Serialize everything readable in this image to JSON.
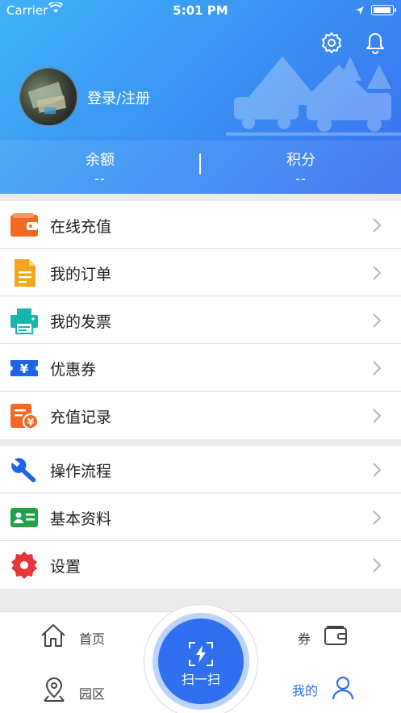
{
  "status_bar": {
    "carrier": "Carrier",
    "time": "5:01 PM"
  },
  "header": {
    "login_label": "登录/注册"
  },
  "stats": {
    "balance": {
      "label": "余额",
      "value": "--"
    },
    "points": {
      "label": "积分",
      "value": "--"
    }
  },
  "menu": {
    "group1": [
      {
        "label": "在线充值",
        "icon": "wallet-icon"
      },
      {
        "label": "我的订单",
        "icon": "document-icon"
      },
      {
        "label": "我的发票",
        "icon": "printer-icon"
      },
      {
        "label": "优惠券",
        "icon": "coupon-icon"
      },
      {
        "label": "充值记录",
        "icon": "recharge-record-icon"
      }
    ],
    "group2": [
      {
        "label": "操作流程",
        "icon": "wrench-icon"
      },
      {
        "label": "基本资料",
        "icon": "id-card-icon"
      },
      {
        "label": "设置",
        "icon": "settings-gear-icon"
      }
    ]
  },
  "tabbar": {
    "home": "首页",
    "coupon": "券",
    "park": "园区",
    "scan": "扫一扫",
    "mine": "我的"
  },
  "colors": {
    "header_start": "#3fb2f7",
    "header_end": "#3a6ff0",
    "scan_button": "#2f6ff0",
    "active_tab": "#2f6ff0"
  }
}
